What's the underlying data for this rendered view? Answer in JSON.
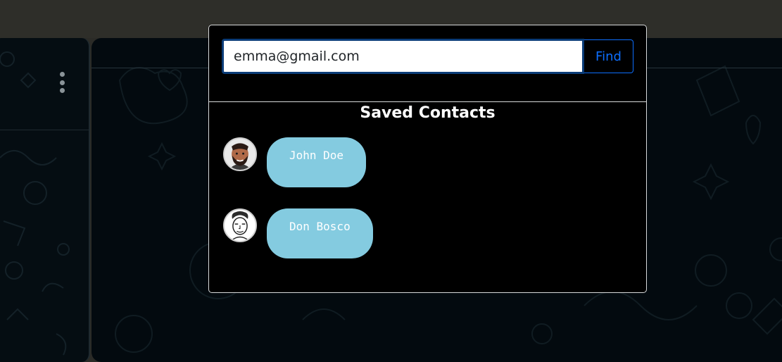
{
  "search": {
    "value": "emma@gmail.com",
    "button_label": "Find"
  },
  "saved_contacts": {
    "title": "Saved Contacts",
    "items": [
      {
        "name": "John Doe",
        "avatar_icon": "bearded-man-avatar-icon"
      },
      {
        "name": "Don Bosco",
        "avatar_icon": "man-sketch-avatar-icon"
      }
    ]
  },
  "colors": {
    "modal_bg": "#000000",
    "contact_pill": "#84cbe0",
    "find_button": "#0d6efd",
    "input_border": "#0b3c78",
    "app_bg": "#030a0f"
  },
  "icons": {
    "menu": "kebab-menu-icon"
  }
}
